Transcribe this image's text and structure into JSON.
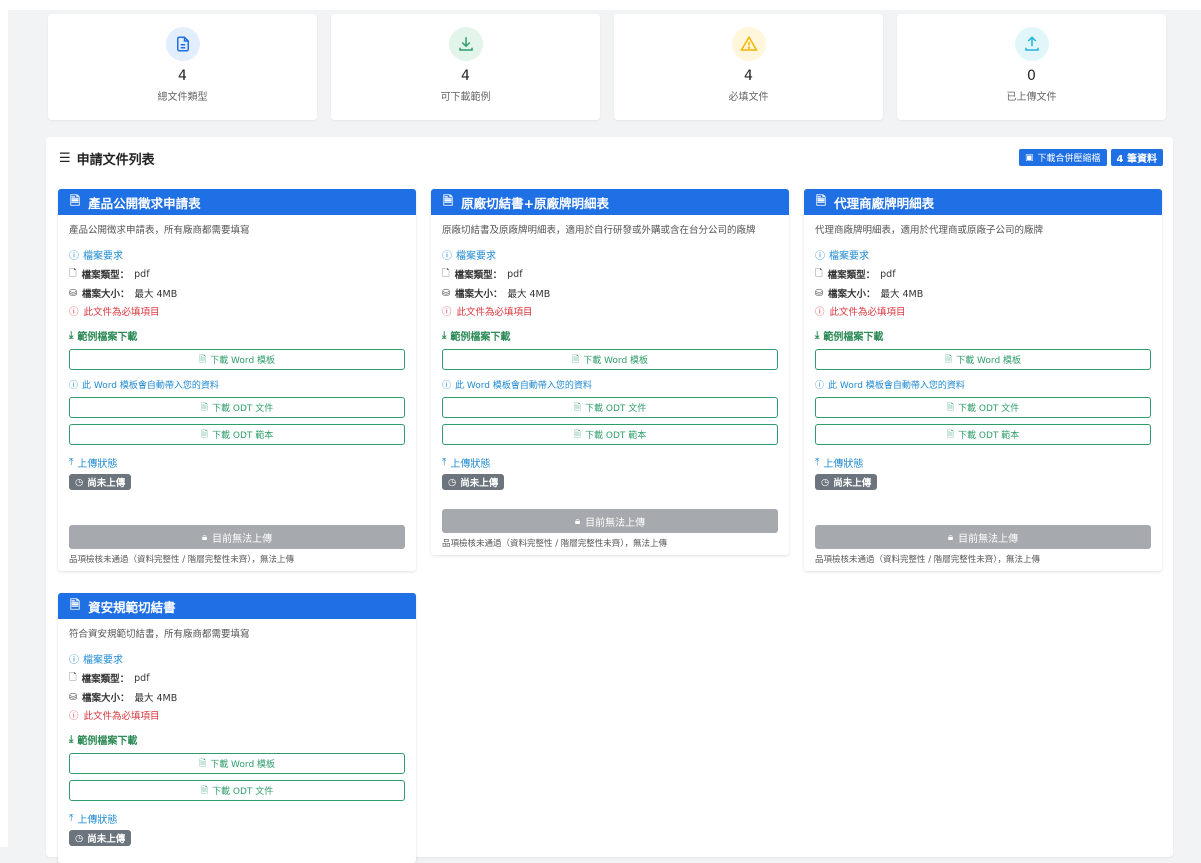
{
  "stats": [
    {
      "icon": "file-text-icon",
      "value": "4",
      "label": "總文件類型",
      "color": "#1f6fe5",
      "bg": "#e3eefc"
    },
    {
      "icon": "download-icon",
      "value": "4",
      "label": "可下載範例",
      "color": "#2e9d6a",
      "bg": "#e3f4ea"
    },
    {
      "icon": "warning-icon",
      "value": "4",
      "label": "必填文件",
      "color": "#f5b400",
      "bg": "#fff6dc"
    },
    {
      "icon": "upload-icon",
      "value": "0",
      "label": "已上傳文件",
      "color": "#1fb4d8",
      "bg": "#e0f6fb"
    }
  ],
  "panel": {
    "title": "申請文件列表",
    "zip_button": "下載合併壓縮檔",
    "count_badge": "4 筆資料"
  },
  "common": {
    "req_title": "檔案要求",
    "type_label": "檔案類型：",
    "type_value": "pdf",
    "size_label": "檔案大小：",
    "size_value": "最大 4MB",
    "required_text": "此文件為必填項目",
    "sample_title": "範例檔案下載",
    "word_btn": "下載 Word 模板",
    "word_hint": "此 Word 模板會自動帶入您的資料",
    "odt_doc_btn": "下載 ODT 文件",
    "odt_sample_btn": "下載 ODT 範本",
    "upload_title": "上傳狀態",
    "status": "尚未上傳",
    "upload_disabled": "目前無法上傳",
    "upload_note": "品項檢核未通過（資料完整性 / 階層完整性未齊），無法上傳"
  },
  "cards": [
    {
      "title": "產品公開徵求申請表",
      "desc": "產品公開徵求申請表，所有廠商都需要填寫"
    },
    {
      "title": "原廠切結書+原廠牌明細表",
      "desc": "原廠切結書及原廠牌明細表，適用於自行研發或外購或含在台分公司的廠牌"
    },
    {
      "title": "代理商廠牌明細表",
      "desc": "代理商廠牌明細表，適用於代理商或原廠子公司的廠牌"
    },
    {
      "title": "資安規範切結書",
      "desc": "符合資安規範切結書，所有廠商都需要填寫"
    }
  ]
}
